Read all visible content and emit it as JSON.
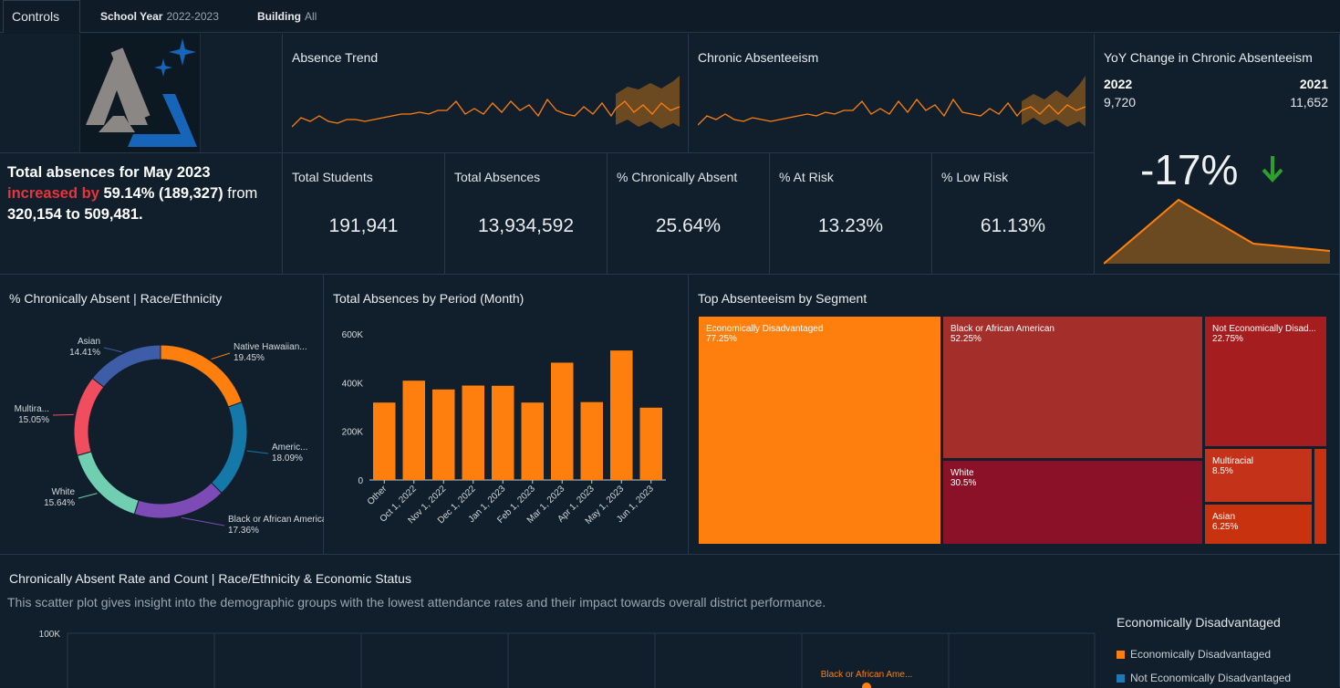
{
  "controls": {
    "tab_label": "Controls",
    "school_year_label": "School Year",
    "school_year_value": "2022-2023",
    "building_label": "Building",
    "building_value": "All"
  },
  "logo": {
    "icon": "triangle-sparkle-logo"
  },
  "absence_trend": {
    "title": "Absence Trend"
  },
  "chronic_absenteeism": {
    "title": "Chronic Absenteeism"
  },
  "yoy": {
    "title": "YoY Change in Chronic Absenteeism",
    "left_year": "2022",
    "left_value": "9,720",
    "right_year": "2021",
    "right_value": "11,652",
    "change": "-17%",
    "arrow_icon": "arrow-down-icon",
    "arrow_color": "#2ca02c"
  },
  "insight": {
    "line1": "Total absences for May 2023",
    "increased": "increased by",
    "change": " 59.14% (189,327)",
    "from": " from",
    "line3": "320,154 to 509,481."
  },
  "kpis": [
    {
      "title": "Total Students",
      "value": "191,941"
    },
    {
      "title": "Total Absences",
      "value": "13,934,592"
    },
    {
      "title": "% Chronically Absent",
      "value": "25.64%"
    },
    {
      "title": "% At Risk",
      "value": "13.23%"
    },
    {
      "title": "% Low Risk",
      "value": "61.13%"
    }
  ],
  "donut": {
    "title": "% Chronically Absent  |  Race/Ethnicity",
    "segments": [
      {
        "label": "Native Hawaiian...",
        "pct": "19.45%",
        "value": 19.45,
        "color": "#ff7f0e"
      },
      {
        "label": "Americ...",
        "pct": "18.09%",
        "value": 18.09,
        "color": "#1479a8"
      },
      {
        "label": "Black or African American",
        "pct": "17.36%",
        "value": 17.36,
        "color": "#7c4bb5"
      },
      {
        "label": "White",
        "pct": "15.64%",
        "value": 15.64,
        "color": "#6fcfb0"
      },
      {
        "label": "Multira...",
        "pct": "15.05%",
        "value": 15.05,
        "color": "#f04d5e"
      },
      {
        "label": "Asian",
        "pct": "14.41%",
        "value": 14.41,
        "color": "#3e5da8"
      }
    ]
  },
  "bar_panel": {
    "title": "Total Absences by Period (Month)"
  },
  "chart_data": [
    {
      "type": "bar",
      "title": "Total Absences by Period (Month)",
      "categories": [
        "Other",
        "Oct 1, 2022",
        "Nov 1, 2022",
        "Dec 1, 2022",
        "Jan 1, 2023",
        "Feb 1, 2023",
        "Mar 1, 2023",
        "Apr 1, 2023",
        "May 1, 2023",
        "Jun 1, 2023"
      ],
      "values": [
        318000,
        408000,
        372000,
        388000,
        387000,
        318000,
        482000,
        320000,
        532000,
        297000
      ],
      "ylim": [
        0,
        600000
      ],
      "yticks": [
        "0",
        "200K",
        "400K",
        "600K"
      ],
      "color": "#ff7f0e"
    }
  ],
  "treemap": {
    "title": "Top Absenteeism by Segment",
    "cells": [
      {
        "label": "Economically Disadvantaged",
        "pct": "77.25%",
        "color": "#ff7f0e"
      },
      {
        "label": "Black or African American",
        "pct": "52.25%",
        "color": "#a42e2a"
      },
      {
        "label": "Not Economically Disad...",
        "pct": "22.75%",
        "color": "#a51d1e"
      },
      {
        "label": "White",
        "pct": "30.5%",
        "color": "#8a1127"
      },
      {
        "label": "Multiracial",
        "pct": "8.5%",
        "color": "#c4321a"
      },
      {
        "label": "Asian",
        "pct": "6.25%",
        "color": "#c8320f"
      }
    ]
  },
  "scatter": {
    "title": "Chronically Absent Rate and Count  |  Race/Ethnicity & Economic Status",
    "subtitle": "This scatter plot gives insight into the demographic groups with the lowest attendance rates and their impact towards overall district performance.",
    "ytick_top": "100K",
    "point_label": "Black or African Ame...",
    "legend_title": "Economically Disadvantaged",
    "legend": [
      {
        "label": "Economically Disadvantaged",
        "color": "#ff7f0e"
      },
      {
        "label": "Not Economically Disadvantaged",
        "color": "#1f77b4"
      }
    ]
  }
}
